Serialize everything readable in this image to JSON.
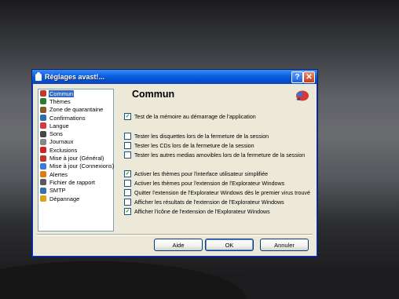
{
  "window": {
    "title": "Réglages avast!...",
    "help_label": "?",
    "close_label": "✕"
  },
  "sidebar": {
    "items": [
      {
        "label": "Commun",
        "icon": "heart-icon",
        "color": "#c0392b",
        "selected": true
      },
      {
        "label": "Thèmes",
        "icon": "palette-icon",
        "color": "#2c7a2c"
      },
      {
        "label": "Zone de quarantaine",
        "icon": "chest-icon",
        "color": "#8b5a2b"
      },
      {
        "label": "Confirmations",
        "icon": "confirm-icon",
        "color": "#2d6db5"
      },
      {
        "label": "Langue",
        "icon": "flag-icon",
        "color": "#d43c3c"
      },
      {
        "label": "Sons",
        "icon": "speaker-icon",
        "color": "#444444"
      },
      {
        "label": "Journaux",
        "icon": "log-icon",
        "color": "#888888"
      },
      {
        "label": "Exclusions",
        "icon": "exclusion-icon",
        "color": "#d62020"
      },
      {
        "label": "Mise à jour (Général)",
        "icon": "update-icon",
        "color": "#c0392b"
      },
      {
        "label": "Mise à jour (Connexions)",
        "icon": "connection-icon",
        "color": "#3a7bd5"
      },
      {
        "label": "Alertes",
        "icon": "alert-icon",
        "color": "#e07b14"
      },
      {
        "label": "Fichier de rapport",
        "icon": "report-icon",
        "color": "#5a5a5a"
      },
      {
        "label": "SMTP",
        "icon": "mail-icon",
        "color": "#3a6fb0"
      },
      {
        "label": "Dépannage",
        "icon": "repair-icon",
        "color": "#d9a514"
      }
    ]
  },
  "panel": {
    "title": "Commun",
    "options": [
      {
        "label": "Test de la mémoire au démarrage de l'application",
        "checked": true
      },
      {
        "label": "Tester les disquettes lors de la fermeture de la session",
        "checked": false
      },
      {
        "label": "Tester les CDs lors de la fermeture de la session",
        "checked": false
      },
      {
        "label": "Tester les autres medias amovibles lors de la fermeture de la session",
        "checked": false
      },
      {
        "label": "Activer les thèmes pour l'interface utilisateur simplifiée",
        "checked": true
      },
      {
        "label": "Activer les thèmes pour l'extension de l'Explorateur Windows",
        "checked": false
      },
      {
        "label": "Quitter l'extension de l'Explorateur Windows dès le premier virus trouvé",
        "checked": false
      },
      {
        "label": "Afficher les résultats de l'extension de l'Explorateur Windows",
        "checked": false
      },
      {
        "label": "Afficher l'icône de l'extension de l'Explorateur Windows",
        "checked": true
      }
    ]
  },
  "buttons": {
    "help": "Aide",
    "ok": "OK",
    "cancel": "Annuler"
  },
  "colors": {
    "titlebar": "#0a5fe0",
    "selection": "#316ac5",
    "dialog_bg": "#ece9d8",
    "brand": "#d63a2f"
  }
}
